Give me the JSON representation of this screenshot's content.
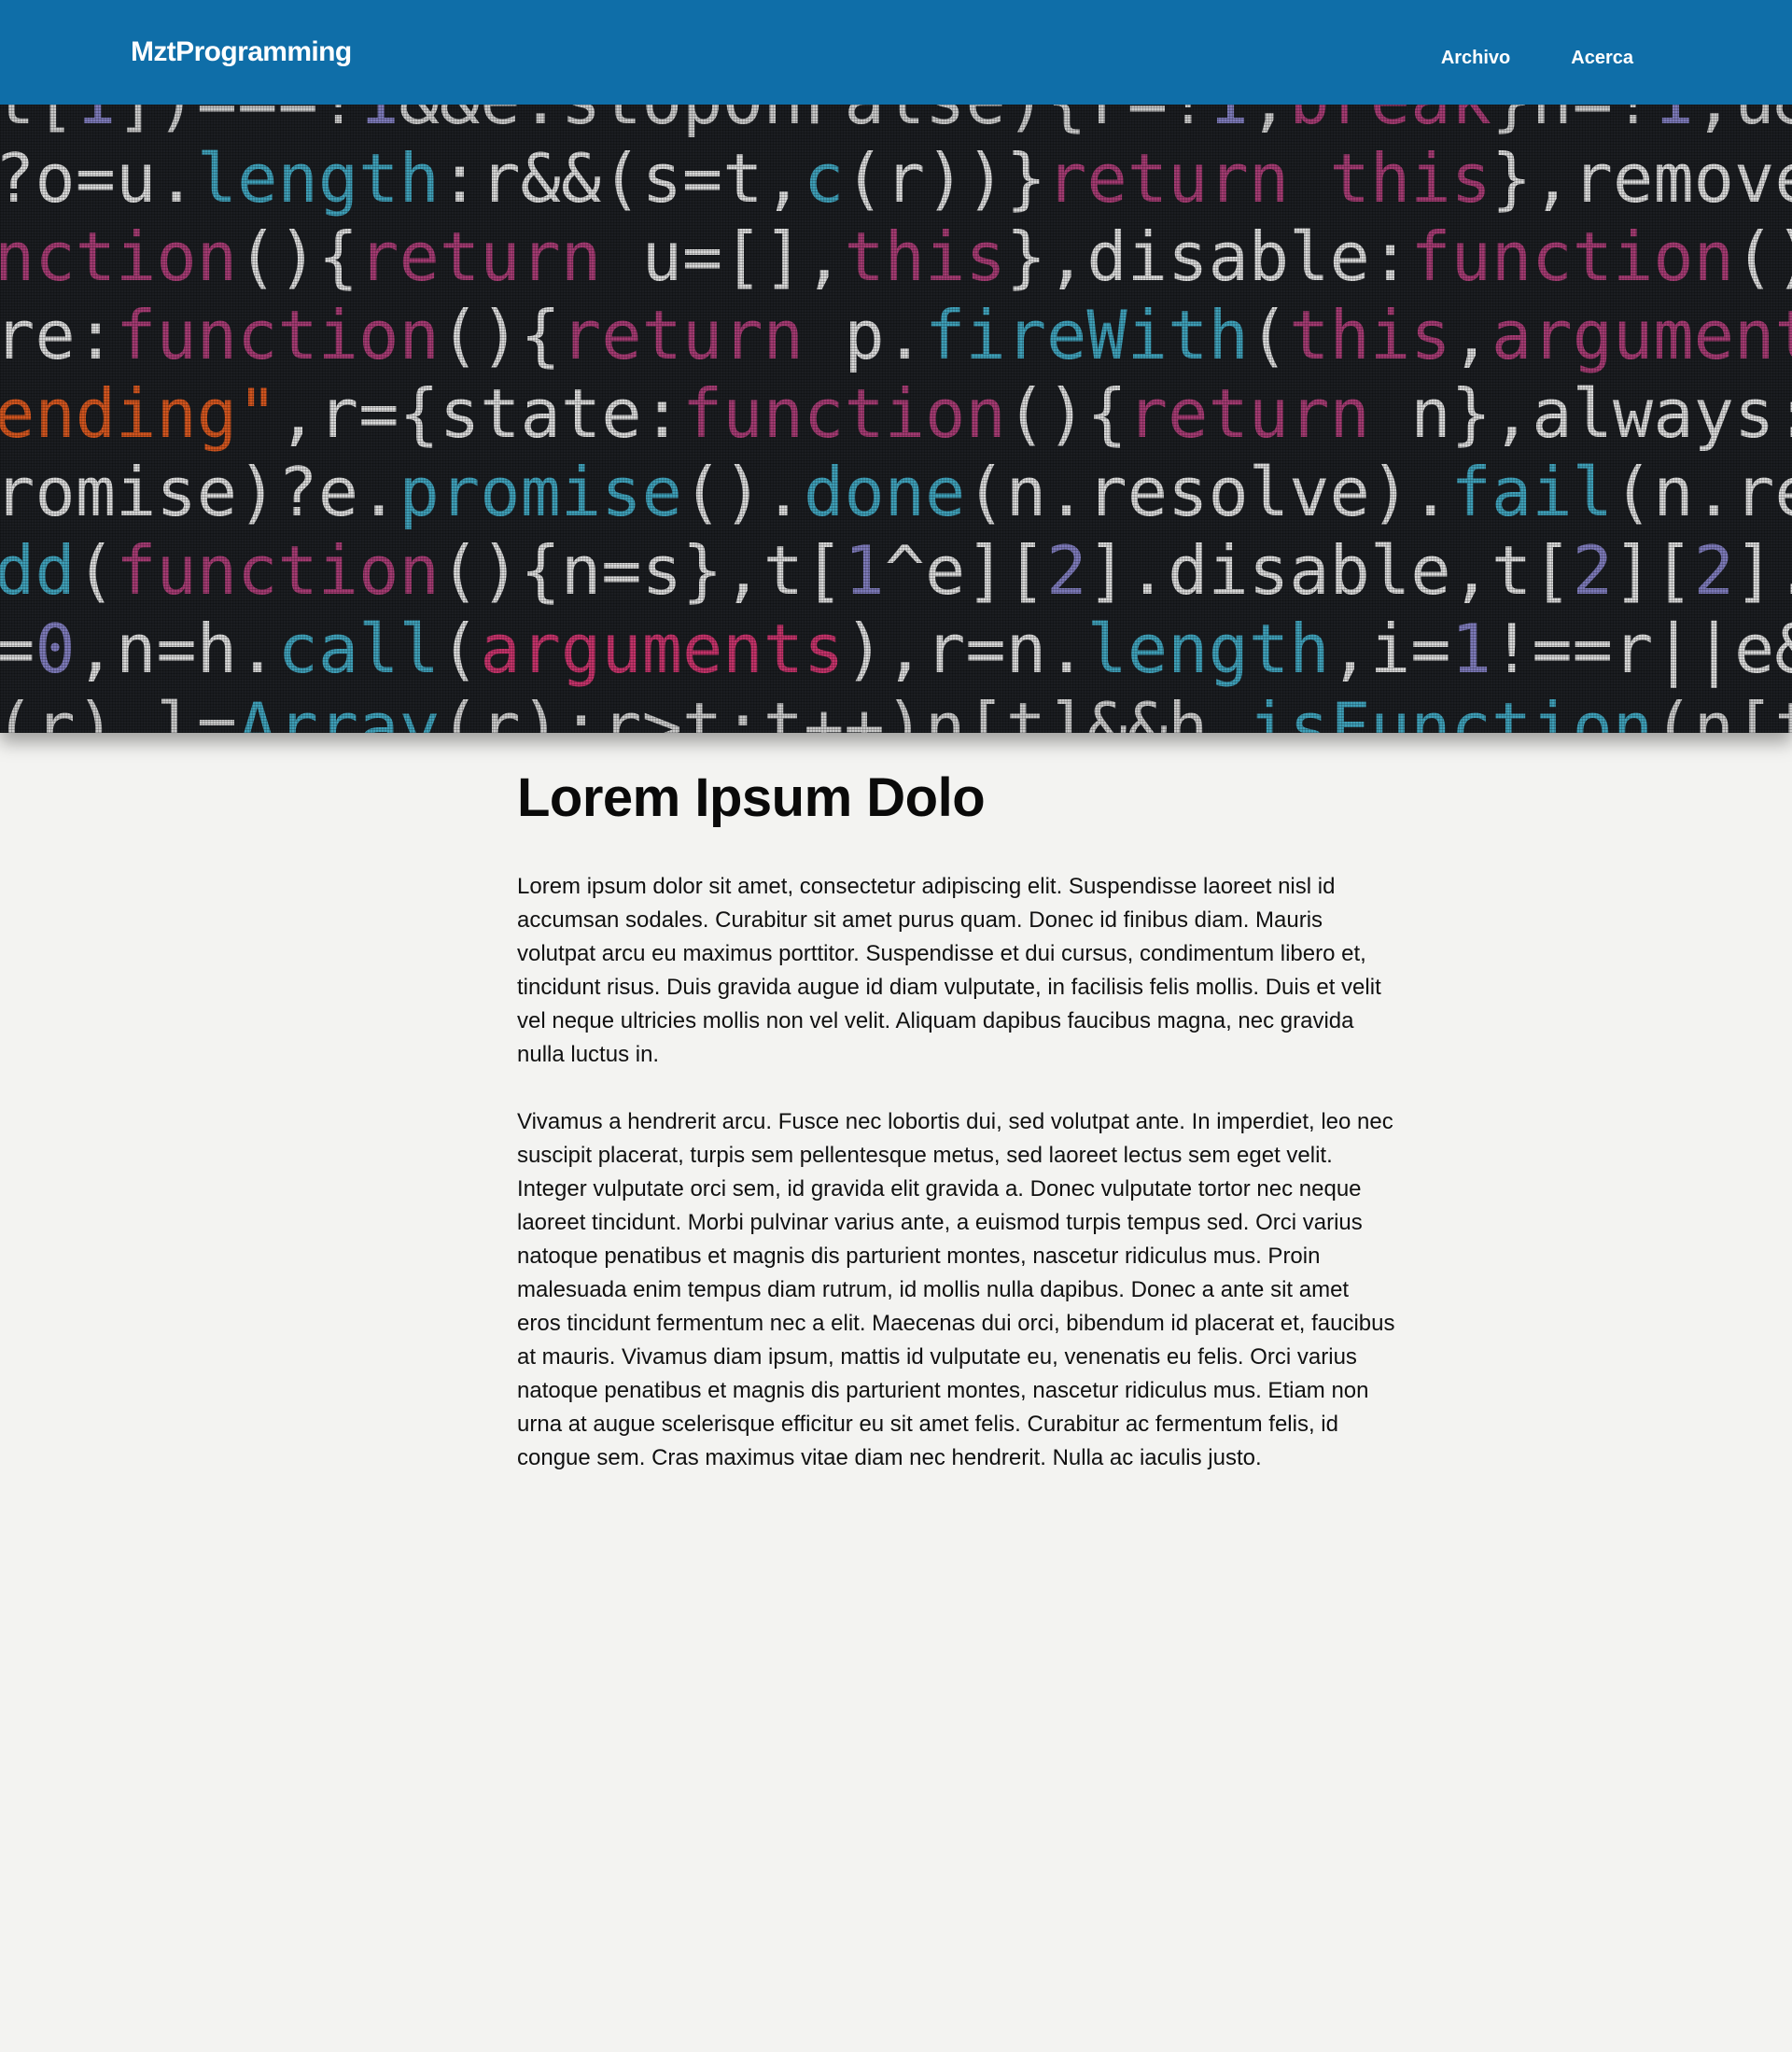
{
  "header": {
    "brand": "MztProgramming",
    "nav": [
      {
        "label": "Archivo"
      },
      {
        "label": "Acerca"
      }
    ],
    "background_color": "#0f6ea8"
  },
  "hero": {
    "code_lines": [
      [
        [
          "t[",
          "#c9c9c9"
        ],
        [
          "1",
          "#7d7ab9"
        ],
        [
          "])===!",
          "#c9c9c9"
        ],
        [
          "1",
          "#7d7ab9"
        ],
        [
          "&&e.stopOnFalse){r=!",
          "#c9c9c9"
        ],
        [
          "1",
          "#7d7ab9"
        ],
        [
          ",",
          "#c9c9c9"
        ],
        [
          "break",
          "#a43b72"
        ],
        [
          "}n=!",
          "#c9c9c9"
        ],
        [
          "1",
          "#7d7ab9"
        ],
        [
          ",u&&",
          "#c9c9c9"
        ]
      ],
      [
        [
          "?o=u.",
          "#d9d9d9"
        ],
        [
          "length",
          "#3fa0b9"
        ],
        [
          ":r&&(s=t,",
          "#d9d9d9"
        ],
        [
          "c",
          "#3fa0b9"
        ],
        [
          "(r))}",
          "#d9d9d9"
        ],
        [
          "return this",
          "#a43b72"
        ],
        [
          "},remove",
          "#d9d9d9"
        ]
      ],
      [
        [
          "nction",
          "#a43b72"
        ],
        [
          "(){",
          "#d9d9d9"
        ],
        [
          "return",
          "#a43b72"
        ],
        [
          " u=[],",
          "#d9d9d9"
        ],
        [
          "this",
          "#a43b72"
        ],
        [
          "},disable:",
          "#d9d9d9"
        ],
        [
          "function",
          "#a43b72"
        ],
        [
          "()",
          "#d9d9d9"
        ]
      ],
      [
        [
          "re:",
          "#d9d9d9"
        ],
        [
          "function",
          "#a43b72"
        ],
        [
          "(){",
          "#d9d9d9"
        ],
        [
          "return",
          "#a43b72"
        ],
        [
          " p.",
          "#d9d9d9"
        ],
        [
          "fireWith",
          "#3fa0b9"
        ],
        [
          "(",
          "#d9d9d9"
        ],
        [
          "this",
          "#a43b72"
        ],
        [
          ",",
          "#d9d9d9"
        ],
        [
          "arguments",
          "#a43b72"
        ]
      ],
      [
        [
          "ending\"",
          "#d1551f"
        ],
        [
          ",r={state:",
          "#d9d9d9"
        ],
        [
          "function",
          "#a43b72"
        ],
        [
          "(){",
          "#d9d9d9"
        ],
        [
          "return",
          "#a43b72"
        ],
        [
          " n},always:",
          "#d9d9d9"
        ]
      ],
      [
        [
          "romise)?e.",
          "#d9d9d9"
        ],
        [
          "promise",
          "#3fa0b9"
        ],
        [
          "().",
          "#d9d9d9"
        ],
        [
          "done",
          "#3fa0b9"
        ],
        [
          "(n.resolve).",
          "#d9d9d9"
        ],
        [
          "fail",
          "#3fa0b9"
        ],
        [
          "(n.re",
          "#d9d9d9"
        ]
      ],
      [
        [
          "dd",
          "#3fa0b9"
        ],
        [
          "(",
          "#d9d9d9"
        ],
        [
          "function",
          "#a43b72"
        ],
        [
          "(){n=s},t[",
          "#d9d9d9"
        ],
        [
          "1",
          "#7d7ab9"
        ],
        [
          "^e][",
          "#d9d9d9"
        ],
        [
          "2",
          "#7d7ab9"
        ],
        [
          "].disable,t[",
          "#d9d9d9"
        ],
        [
          "2",
          "#7d7ab9"
        ],
        [
          "][",
          "#d9d9d9"
        ],
        [
          "2",
          "#7d7ab9"
        ],
        [
          "].",
          "#d9d9d9"
        ]
      ],
      [
        [
          "=",
          "#d9d9d9"
        ],
        [
          "0",
          "#7d7ab9"
        ],
        [
          ",n=h.",
          "#d9d9d9"
        ],
        [
          "call",
          "#3fa0b9"
        ],
        [
          "(",
          "#d9d9d9"
        ],
        [
          "arguments",
          "#c4336a"
        ],
        [
          "),r=n.",
          "#d9d9d9"
        ],
        [
          "length",
          "#3fa0b9"
        ],
        [
          ",i=",
          "#d9d9d9"
        ],
        [
          "1",
          "#7d7ab9"
        ],
        [
          "!==r||e&&",
          "#d9d9d9"
        ]
      ],
      [
        [
          "(r),l=",
          "#c9c9c9"
        ],
        [
          "Array",
          "#3fa0b9"
        ],
        [
          "(r);r>t;t++)n[t]&&h.",
          "#c9c9c9"
        ],
        [
          "isFunction",
          "#3fa0b9"
        ],
        [
          "(n[t",
          "#c9c9c9"
        ]
      ]
    ]
  },
  "article": {
    "title": "Lorem Ipsum Dolo",
    "paragraphs": [
      "Lorem ipsum dolor sit amet, consectetur adipiscing elit. Suspendisse laoreet nisl id accumsan sodales. Curabitur sit amet purus quam. Donec id finibus diam. Mauris volutpat arcu eu maximus porttitor. Suspendisse et dui cursus, condimentum libero et, tincidunt risus. Duis gravida augue id diam vulputate, in facilisis felis mollis. Duis et velit vel neque ultricies mollis non vel velit. Aliquam dapibus faucibus magna, nec gravida nulla luctus in.",
      "Vivamus a hendrerit arcu. Fusce nec lobortis dui, sed volutpat ante. In imperdiet, leo nec suscipit placerat, turpis sem pellentesque metus, sed laoreet lectus sem eget velit. Integer vulputate orci sem, id gravida elit gravida a. Donec vulputate tortor nec neque laoreet tincidunt. Morbi pulvinar varius ante, a euismod turpis tempus sed. Orci varius natoque penatibus et magnis dis parturient montes, nascetur ridiculus mus. Proin malesuada enim tempus diam rutrum, id mollis nulla dapibus. Donec a ante sit amet eros tincidunt fermentum nec a elit. Maecenas dui orci, bibendum id placerat et, faucibus at mauris. Vivamus diam ipsum, mattis id vulputate eu, venenatis eu felis. Orci varius natoque penatibus et magnis dis parturient montes, nascetur ridiculus mus. Etiam non urna at augue scelerisque efficitur eu sit amet felis. Curabitur ac fermentum felis, id congue sem. Cras maximus vitae diam nec hendrerit. Nulla ac iaculis justo."
    ]
  }
}
